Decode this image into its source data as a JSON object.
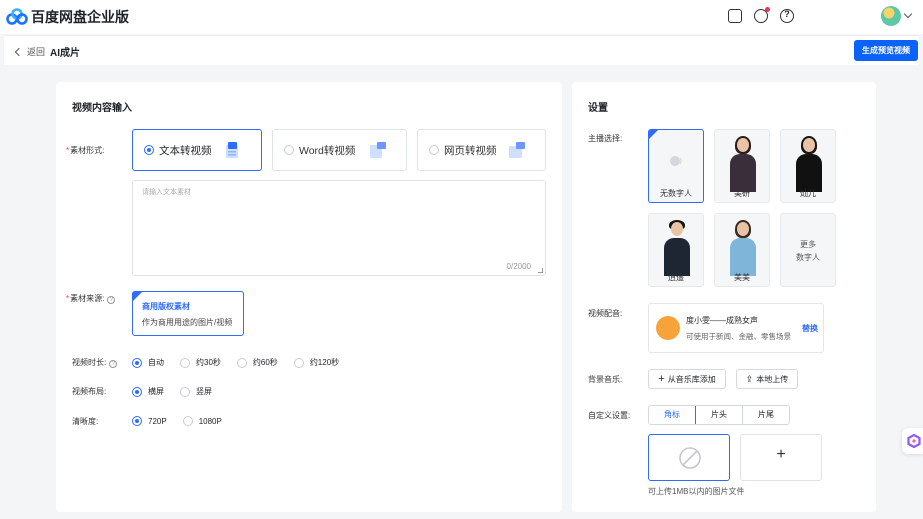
{
  "app": {
    "title": "百度网盘企业版"
  },
  "header": {
    "back_label": "返回",
    "page_title": "AI成片",
    "generate_button": "生成预览视频"
  },
  "left": {
    "title": "视频内容输入",
    "material_form": {
      "label": "素材形式:",
      "options": [
        {
          "label": "文本转视频",
          "selected": true
        },
        {
          "label": "Word转视频",
          "selected": false
        },
        {
          "label": "网页转视频",
          "selected": false
        }
      ]
    },
    "text_input": {
      "placeholder": "请输入文本素材",
      "counter": "0/2000"
    },
    "source": {
      "label": "素材来源:",
      "card_title": "商用版权素材",
      "card_desc": "作为商用用途的图片/视频"
    },
    "duration": {
      "label": "视频时长:",
      "options": [
        "自动",
        "约30秒",
        "约60秒",
        "约120秒"
      ],
      "selected": 0
    },
    "layout": {
      "label": "视频布局:",
      "options": [
        "横屏",
        "竖屏"
      ],
      "selected": 0
    },
    "resolution": {
      "label": "清晰度:",
      "options": [
        "720P",
        "1080P"
      ],
      "selected": 0
    }
  },
  "right": {
    "title": "设置",
    "anchor": {
      "label": "主播选择:",
      "items": [
        {
          "name": "无数字人",
          "selected": true
        },
        {
          "name": "美研",
          "selected": false
        },
        {
          "name": "灿儿",
          "selected": false
        },
        {
          "name": "逍遥",
          "selected": false
        },
        {
          "name": "美美",
          "selected": false
        }
      ],
      "more_line1": "更多",
      "more_line2": "数字人"
    },
    "voice": {
      "label": "视频配音:",
      "name": "度小雯——成熟女声",
      "desc": "可使用于新闻、金融、零售场景",
      "swap": "替换"
    },
    "music": {
      "label": "背景音乐:",
      "library_button": "从音乐库添加",
      "upload_button": "本地上传"
    },
    "custom": {
      "label": "自定义设置:",
      "tabs": [
        "角标",
        "片头",
        "片尾"
      ],
      "active_tab": 0,
      "hint": "可上传1MB以内的图片文件"
    }
  },
  "colors": {
    "primary": "#0b62f6",
    "accent": "#2f6bff",
    "required": "#f0344c"
  }
}
